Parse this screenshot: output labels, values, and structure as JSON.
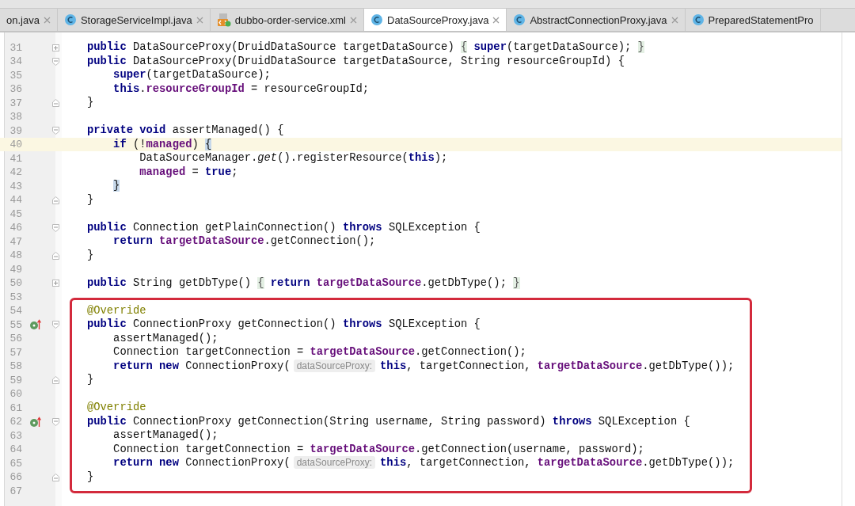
{
  "tabs": [
    {
      "label": "on.java",
      "kind": "plain",
      "selected": false,
      "closable": true
    },
    {
      "label": "StorageServiceImpl.java",
      "kind": "class",
      "selected": false,
      "closable": true
    },
    {
      "label": "dubbo-order-service.xml",
      "kind": "xml",
      "selected": false,
      "closable": true
    },
    {
      "label": "DataSourceProxy.java",
      "kind": "class",
      "selected": true,
      "closable": true
    },
    {
      "label": "AbstractConnectionProxy.java",
      "kind": "class",
      "selected": false,
      "closable": true
    },
    {
      "label": "PreparedStatementPro",
      "kind": "class",
      "selected": false,
      "closable": false
    }
  ],
  "sections": [
    {
      "boxed": false,
      "lines": [
        {
          "number": "31",
          "kind": "collapsed",
          "override": false,
          "current": false,
          "tokens": [
            {
              "kind": "kw",
              "text": "public"
            },
            {
              "kind": "plain",
              "text": " DataSourceProxy(DruidDataSource targetDataSource) "
            },
            {
              "kind": "folded",
              "text": "{"
            },
            {
              "kind": "kw",
              "text": " super"
            },
            {
              "kind": "plain",
              "text": "(targetDataSource); "
            },
            {
              "kind": "folded",
              "text": "}"
            }
          ]
        },
        {
          "number": "34",
          "kind": "opener",
          "override": false,
          "current": false,
          "tokens": [
            {
              "kind": "kw",
              "text": "public"
            },
            {
              "kind": "plain",
              "text": " DataSourceProxy(DruidDataSource targetDataSource, String resourceGroupId) {"
            }
          ]
        },
        {
          "number": "35",
          "kind": "body",
          "override": false,
          "current": false,
          "tokens": [
            {
              "kind": "kw",
              "text": "    super"
            },
            {
              "kind": "plain",
              "text": "(targetDataSource);"
            }
          ]
        },
        {
          "number": "36",
          "kind": "body",
          "override": false,
          "current": false,
          "tokens": [
            {
              "kind": "kw",
              "text": "    this"
            },
            {
              "kind": "plain",
              "text": "."
            },
            {
              "kind": "field",
              "text": "resourceGroupId"
            },
            {
              "kind": "plain",
              "text": " = resourceGroupId;"
            }
          ]
        },
        {
          "number": "37",
          "kind": "closer",
          "override": false,
          "current": false,
          "tokens": [
            {
              "kind": "plain",
              "text": "}"
            }
          ]
        },
        {
          "number": "38",
          "kind": "body",
          "override": false,
          "current": false
        },
        {
          "number": "39",
          "kind": "opener",
          "override": false,
          "current": false,
          "tokens": [
            {
              "kind": "kw",
              "text": "private"
            },
            {
              "kind": "kw",
              "text": " void"
            },
            {
              "kind": "plain",
              "text": " assertManaged() {"
            }
          ]
        },
        {
          "number": "40",
          "kind": "body",
          "override": false,
          "current": true,
          "tokens": [
            {
              "kind": "kw",
              "text": "    if"
            },
            {
              "kind": "plain",
              "text": " (!"
            },
            {
              "kind": "field",
              "text": "managed"
            },
            {
              "kind": "plain",
              "text": ") "
            },
            {
              "kind": "match",
              "text": "{"
            }
          ]
        },
        {
          "number": "41",
          "kind": "body",
          "override": false,
          "current": false,
          "tokens": [
            {
              "kind": "plain",
              "text": "        DataSourceManager."
            },
            {
              "kind": "italic",
              "text": "get"
            },
            {
              "kind": "plain",
              "text": "().registerResource("
            },
            {
              "kind": "kw",
              "text": "this"
            },
            {
              "kind": "plain",
              "text": ");"
            }
          ]
        },
        {
          "number": "42",
          "kind": "body",
          "override": false,
          "current": false,
          "tokens": [
            {
              "kind": "field",
              "text": "        managed"
            },
            {
              "kind": "plain",
              "text": " = "
            },
            {
              "kind": "kw",
              "text": "true"
            },
            {
              "kind": "plain",
              "text": ";"
            }
          ]
        },
        {
          "number": "43",
          "kind": "body",
          "override": false,
          "current": false,
          "tokens": [
            {
              "kind": "match",
              "text": "    }"
            }
          ]
        },
        {
          "number": "44",
          "kind": "closer",
          "override": false,
          "current": false,
          "tokens": [
            {
              "kind": "plain",
              "text": "}"
            }
          ]
        },
        {
          "number": "45",
          "kind": "body",
          "override": false,
          "current": false
        },
        {
          "number": "46",
          "kind": "opener",
          "override": false,
          "current": false,
          "tokens": [
            {
              "kind": "kw",
              "text": "public"
            },
            {
              "kind": "plain",
              "text": " Connection getPlainConnection() "
            },
            {
              "kind": "kw",
              "text": "throws"
            },
            {
              "kind": "plain",
              "text": " SQLException {"
            }
          ]
        },
        {
          "number": "47",
          "kind": "body",
          "override": false,
          "current": false,
          "tokens": [
            {
              "kind": "kw",
              "text": "    return"
            },
            {
              "kind": "field",
              "text": " targetDataSource"
            },
            {
              "kind": "plain",
              "text": ".getConnection();"
            }
          ]
        },
        {
          "number": "48",
          "kind": "closer",
          "override": false,
          "current": false,
          "tokens": [
            {
              "kind": "plain",
              "text": "}"
            }
          ]
        },
        {
          "number": "49",
          "kind": "body",
          "override": false,
          "current": false
        },
        {
          "number": "50",
          "kind": "collapsed",
          "override": false,
          "current": false,
          "tokens": [
            {
              "kind": "kw",
              "text": "public"
            },
            {
              "kind": "plain",
              "text": " String getDbType() "
            },
            {
              "kind": "folded",
              "text": "{"
            },
            {
              "kind": "kw",
              "text": " return"
            },
            {
              "kind": "field",
              "text": " targetDataSource"
            },
            {
              "kind": "plain",
              "text": ".getDbType(); "
            },
            {
              "kind": "folded",
              "text": "}"
            }
          ]
        },
        {
          "number": "53",
          "kind": "body",
          "override": false,
          "current": false
        }
      ]
    },
    {
      "boxed": true,
      "lines": [
        {
          "number": "54",
          "kind": "body",
          "override": false,
          "current": false,
          "tokens": [
            {
              "kind": "anno",
              "text": "@Override"
            }
          ]
        },
        {
          "number": "55",
          "kind": "opener",
          "override": true,
          "current": false,
          "tokens": [
            {
              "kind": "kw",
              "text": "public"
            },
            {
              "kind": "plain",
              "text": " ConnectionProxy getConnection() "
            },
            {
              "kind": "kw",
              "text": "throws"
            },
            {
              "kind": "plain",
              "text": " SQLException {"
            }
          ]
        },
        {
          "number": "56",
          "kind": "body",
          "override": false,
          "current": false,
          "tokens": [
            {
              "kind": "plain",
              "text": "    assertManaged();"
            }
          ]
        },
        {
          "number": "57",
          "kind": "body",
          "override": false,
          "current": false,
          "tokens": [
            {
              "kind": "plain",
              "text": "    Connection targetConnection = "
            },
            {
              "kind": "field",
              "text": "targetDataSource"
            },
            {
              "kind": "plain",
              "text": ".getConnection();"
            }
          ]
        },
        {
          "number": "58",
          "kind": "body",
          "override": false,
          "current": false,
          "tokens": [
            {
              "kind": "kw",
              "text": "    return new"
            },
            {
              "kind": "plain",
              "text": " ConnectionProxy("
            },
            {
              "kind": "hint",
              "text": "dataSourceProxy:"
            },
            {
              "kind": "kw",
              "text": "this"
            },
            {
              "kind": "plain",
              "text": ", targetConnection, "
            },
            {
              "kind": "field",
              "text": "targetDataSource"
            },
            {
              "kind": "plain",
              "text": ".getDbType());"
            }
          ]
        },
        {
          "number": "59",
          "kind": "closer",
          "override": false,
          "current": false,
          "tokens": [
            {
              "kind": "plain",
              "text": "}"
            }
          ]
        },
        {
          "number": "60",
          "kind": "body",
          "override": false,
          "current": false
        },
        {
          "number": "61",
          "kind": "body",
          "override": false,
          "current": false,
          "tokens": [
            {
              "kind": "anno",
              "text": "@Override"
            }
          ]
        },
        {
          "number": "62",
          "kind": "opener",
          "override": true,
          "current": false,
          "tokens": [
            {
              "kind": "kw",
              "text": "public"
            },
            {
              "kind": "plain",
              "text": " ConnectionProxy getConnection(String username, String password) "
            },
            {
              "kind": "kw",
              "text": "throws"
            },
            {
              "kind": "plain",
              "text": " SQLException {"
            }
          ]
        },
        {
          "number": "63",
          "kind": "body",
          "override": false,
          "current": false,
          "tokens": [
            {
              "kind": "plain",
              "text": "    assertManaged();"
            }
          ]
        },
        {
          "number": "64",
          "kind": "body",
          "override": false,
          "current": false,
          "tokens": [
            {
              "kind": "plain",
              "text": "    Connection targetConnection = "
            },
            {
              "kind": "field",
              "text": "targetDataSource"
            },
            {
              "kind": "plain",
              "text": ".getConnection(username, password);"
            }
          ]
        },
        {
          "number": "65",
          "kind": "body",
          "override": false,
          "current": false,
          "tokens": [
            {
              "kind": "kw",
              "text": "    return new"
            },
            {
              "kind": "plain",
              "text": " ConnectionProxy("
            },
            {
              "kind": "hint",
              "text": "dataSourceProxy:"
            },
            {
              "kind": "kw",
              "text": "this"
            },
            {
              "kind": "plain",
              "text": ", targetConnection, "
            },
            {
              "kind": "field",
              "text": "targetDataSource"
            },
            {
              "kind": "plain",
              "text": ".getDbType());"
            }
          ]
        },
        {
          "number": "66",
          "kind": "closer",
          "override": false,
          "current": false,
          "tokens": [
            {
              "kind": "plain",
              "text": "}"
            }
          ]
        }
      ]
    },
    {
      "boxed": false,
      "lines": [
        {
          "number": "67",
          "kind": "body",
          "override": false,
          "current": false
        }
      ]
    }
  ]
}
